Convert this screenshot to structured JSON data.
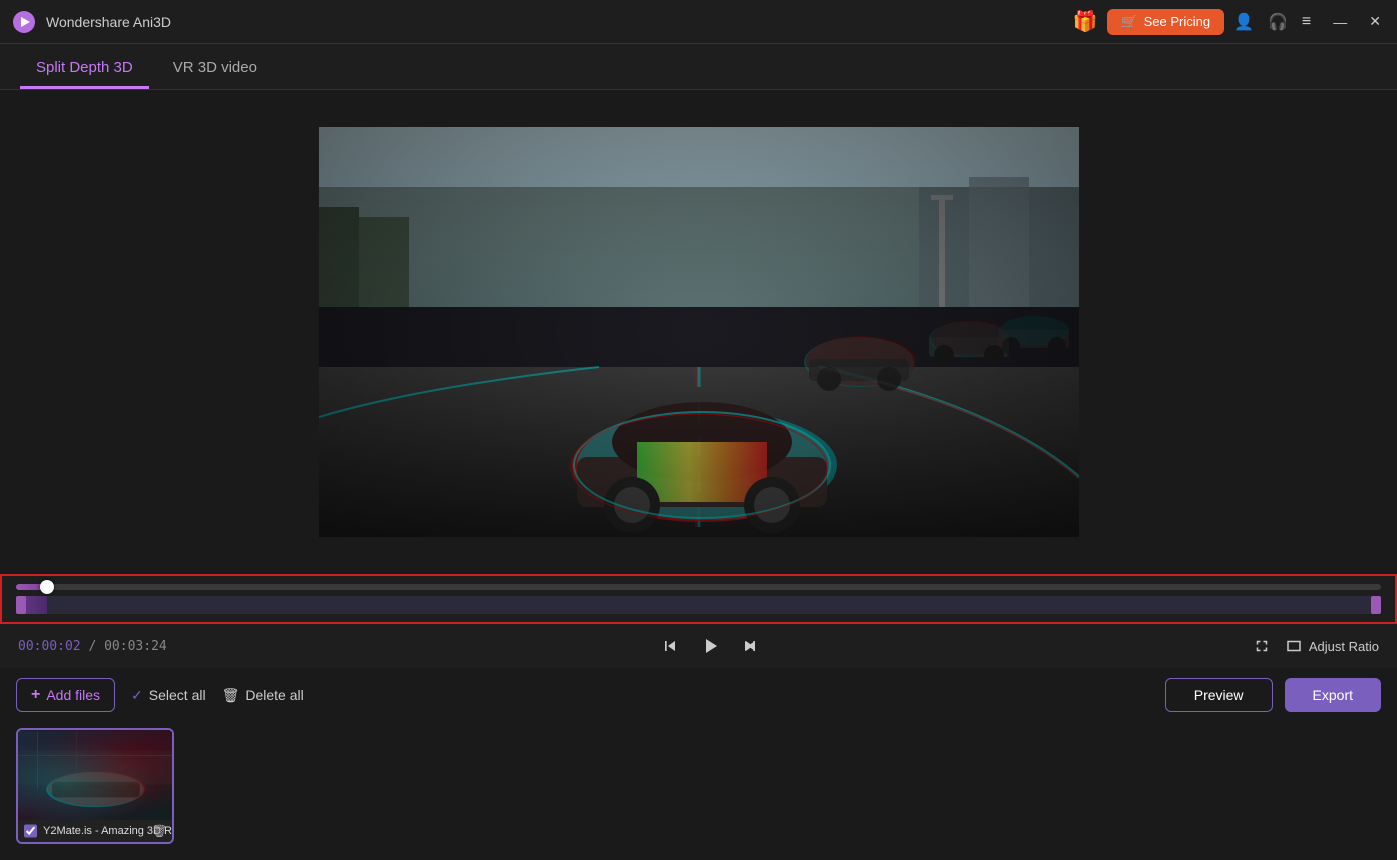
{
  "app": {
    "title": "Wondershare Ani3D",
    "logo_symbol": "▶"
  },
  "titlebar": {
    "gift_icon": "🎁",
    "see_pricing_label": "See Pricing",
    "user_icon": "👤",
    "headphone_icon": "🎧",
    "menu_icon": "≡",
    "minimize_label": "—",
    "close_label": "✕"
  },
  "tabs": [
    {
      "id": "split-depth-3d",
      "label": "Split Depth 3D",
      "active": true
    },
    {
      "id": "vr-3d-video",
      "label": "VR 3D video",
      "active": false
    }
  ],
  "timeline": {
    "border_color": "#cc2222",
    "current_time": "00:00:02",
    "total_time": "00:03:24",
    "progress_pct": 2.3
  },
  "controls": {
    "skip_back_icon": "⏮",
    "play_icon": "▶",
    "skip_forward_icon": "⏭",
    "fullscreen_icon": "⛶",
    "adjust_ratio_label": "Adjust Ratio"
  },
  "toolbar": {
    "add_files_label": "Add files",
    "select_all_label": "Select all",
    "delete_all_label": "Delete all",
    "preview_label": "Preview",
    "export_label": "Export"
  },
  "files": [
    {
      "name": "Y2Mate.is - Amazing 3D R.",
      "selected": true,
      "duration": "00:03:24"
    }
  ],
  "colors": {
    "accent": "#7b5fbf",
    "accent_light": "#c678f5",
    "border_red": "#cc2222",
    "bg_dark": "#1a1a1a",
    "bg_medium": "#1e1e1e",
    "text_muted": "#888",
    "time_color": "#7b5fbf"
  }
}
